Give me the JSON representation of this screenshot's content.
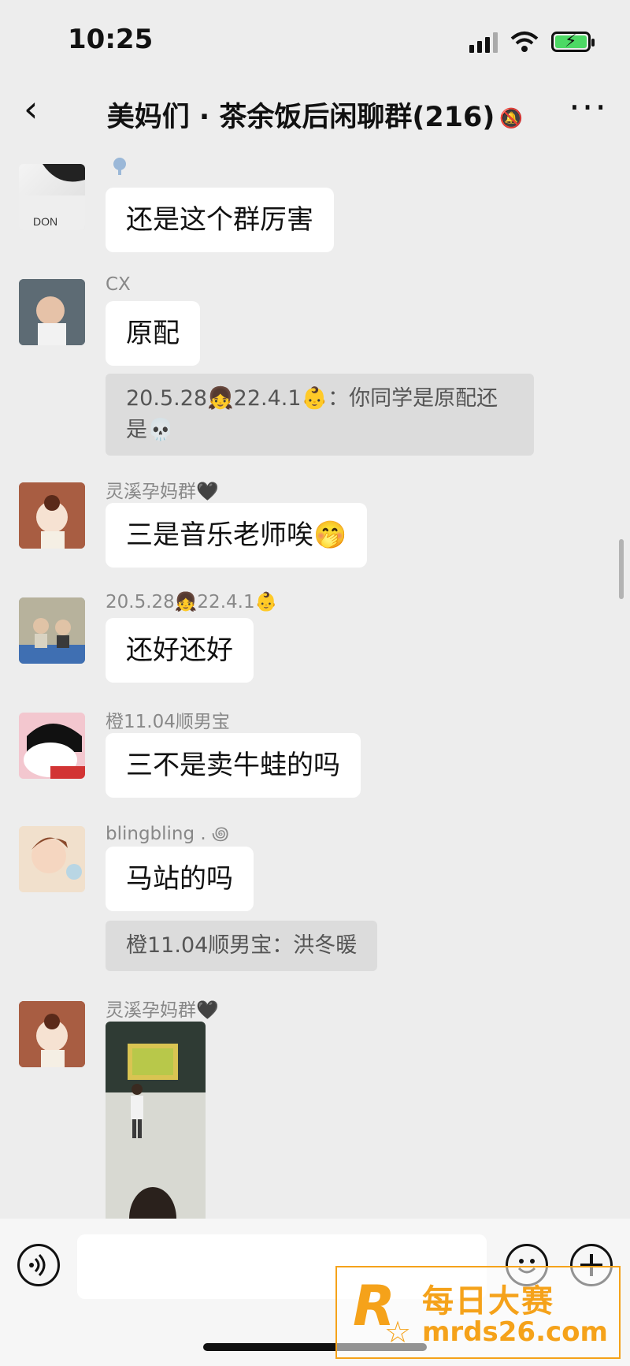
{
  "status_bar": {
    "time": "10:25"
  },
  "nav": {
    "back": "‹",
    "title": "美妈们 · 茶余饭后闲聊群(216)",
    "mute_icon": "muted-bell-icon",
    "more": "···"
  },
  "messages": [
    {
      "sender": "",
      "text": "还是这个群厉害"
    },
    {
      "sender": "CX",
      "text": "原配",
      "quote": "20.5.28👧22.4.1👶：你同学是原配还是💀"
    },
    {
      "sender": "灵溪孕妈群🖤",
      "text": "三是音乐老师唉🤭"
    },
    {
      "sender": "20.5.28👧22.4.1👶",
      "text": "还好还好"
    },
    {
      "sender": "橙11.04顺男宝",
      "text": "三不是卖牛蛙的吗"
    },
    {
      "sender": "blingbling . ꩜",
      "text": "马站的吗",
      "quote": "橙11.04顺男宝：洪冬暖"
    },
    {
      "sender": "灵溪孕妈群🖤",
      "image": "classroom-photo"
    }
  ],
  "input_bar": {
    "voice_icon": "voice-icon",
    "emoji_icon": "emoji-icon",
    "plus_icon": "plus-icon",
    "input_value": ""
  },
  "watermark": {
    "logo": "R",
    "cn": "每日大赛",
    "url": "mrds26.com"
  }
}
